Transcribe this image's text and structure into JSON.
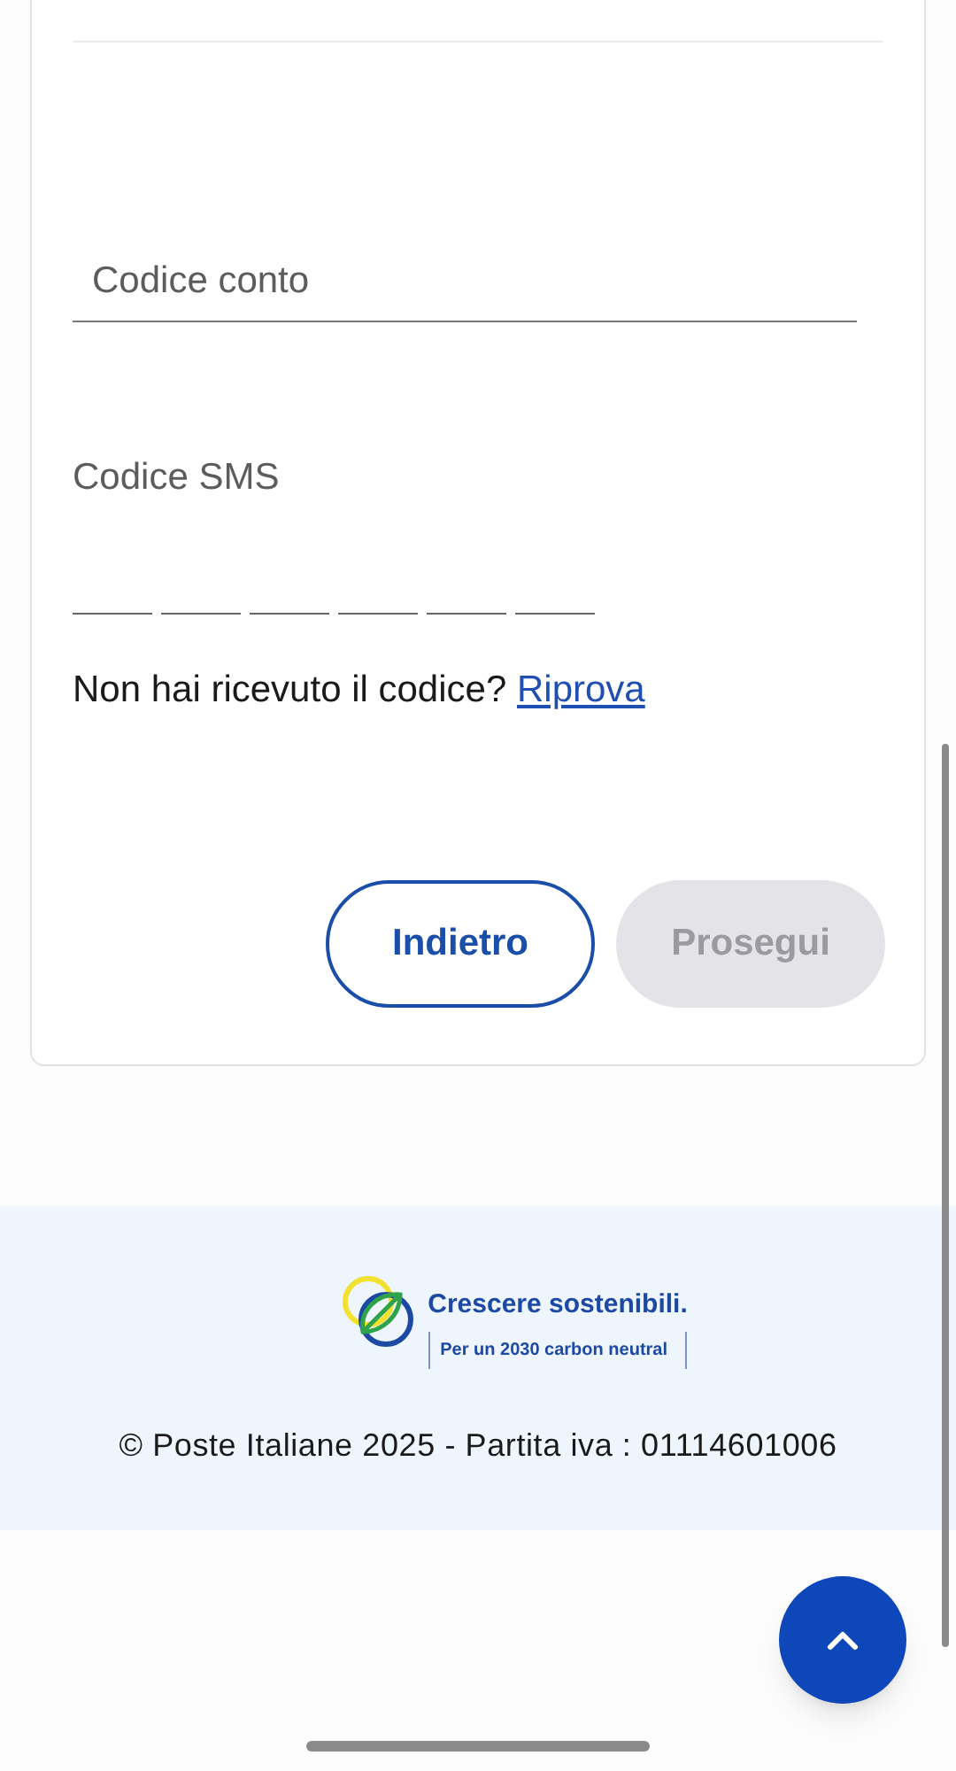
{
  "form": {
    "account_field": {
      "placeholder": "Codice conto"
    },
    "sms_code": {
      "label": "Codice SMS",
      "slots": [
        {
          "kind": "digit"
        },
        {
          "kind": "digit"
        },
        {
          "kind": "digit"
        },
        {
          "kind": "digit"
        },
        {
          "kind": "digit"
        },
        {
          "kind": "digit"
        }
      ]
    },
    "resend": {
      "text": "Non hai ricevuto il codice?",
      "link": "Riprova"
    },
    "buttons": [
      {
        "label": "Indietro",
        "kind": "outline",
        "disabled": false
      },
      {
        "label": "Prosegui",
        "kind": "filled",
        "disabled": true
      }
    ]
  },
  "footer": {
    "logo": {
      "title": "Crescere sostenibili.",
      "subtitle": "Per un 2030 carbon neutral"
    },
    "copyright": "© Poste Italiane 2025 - Partita iva : 01114601006"
  }
}
